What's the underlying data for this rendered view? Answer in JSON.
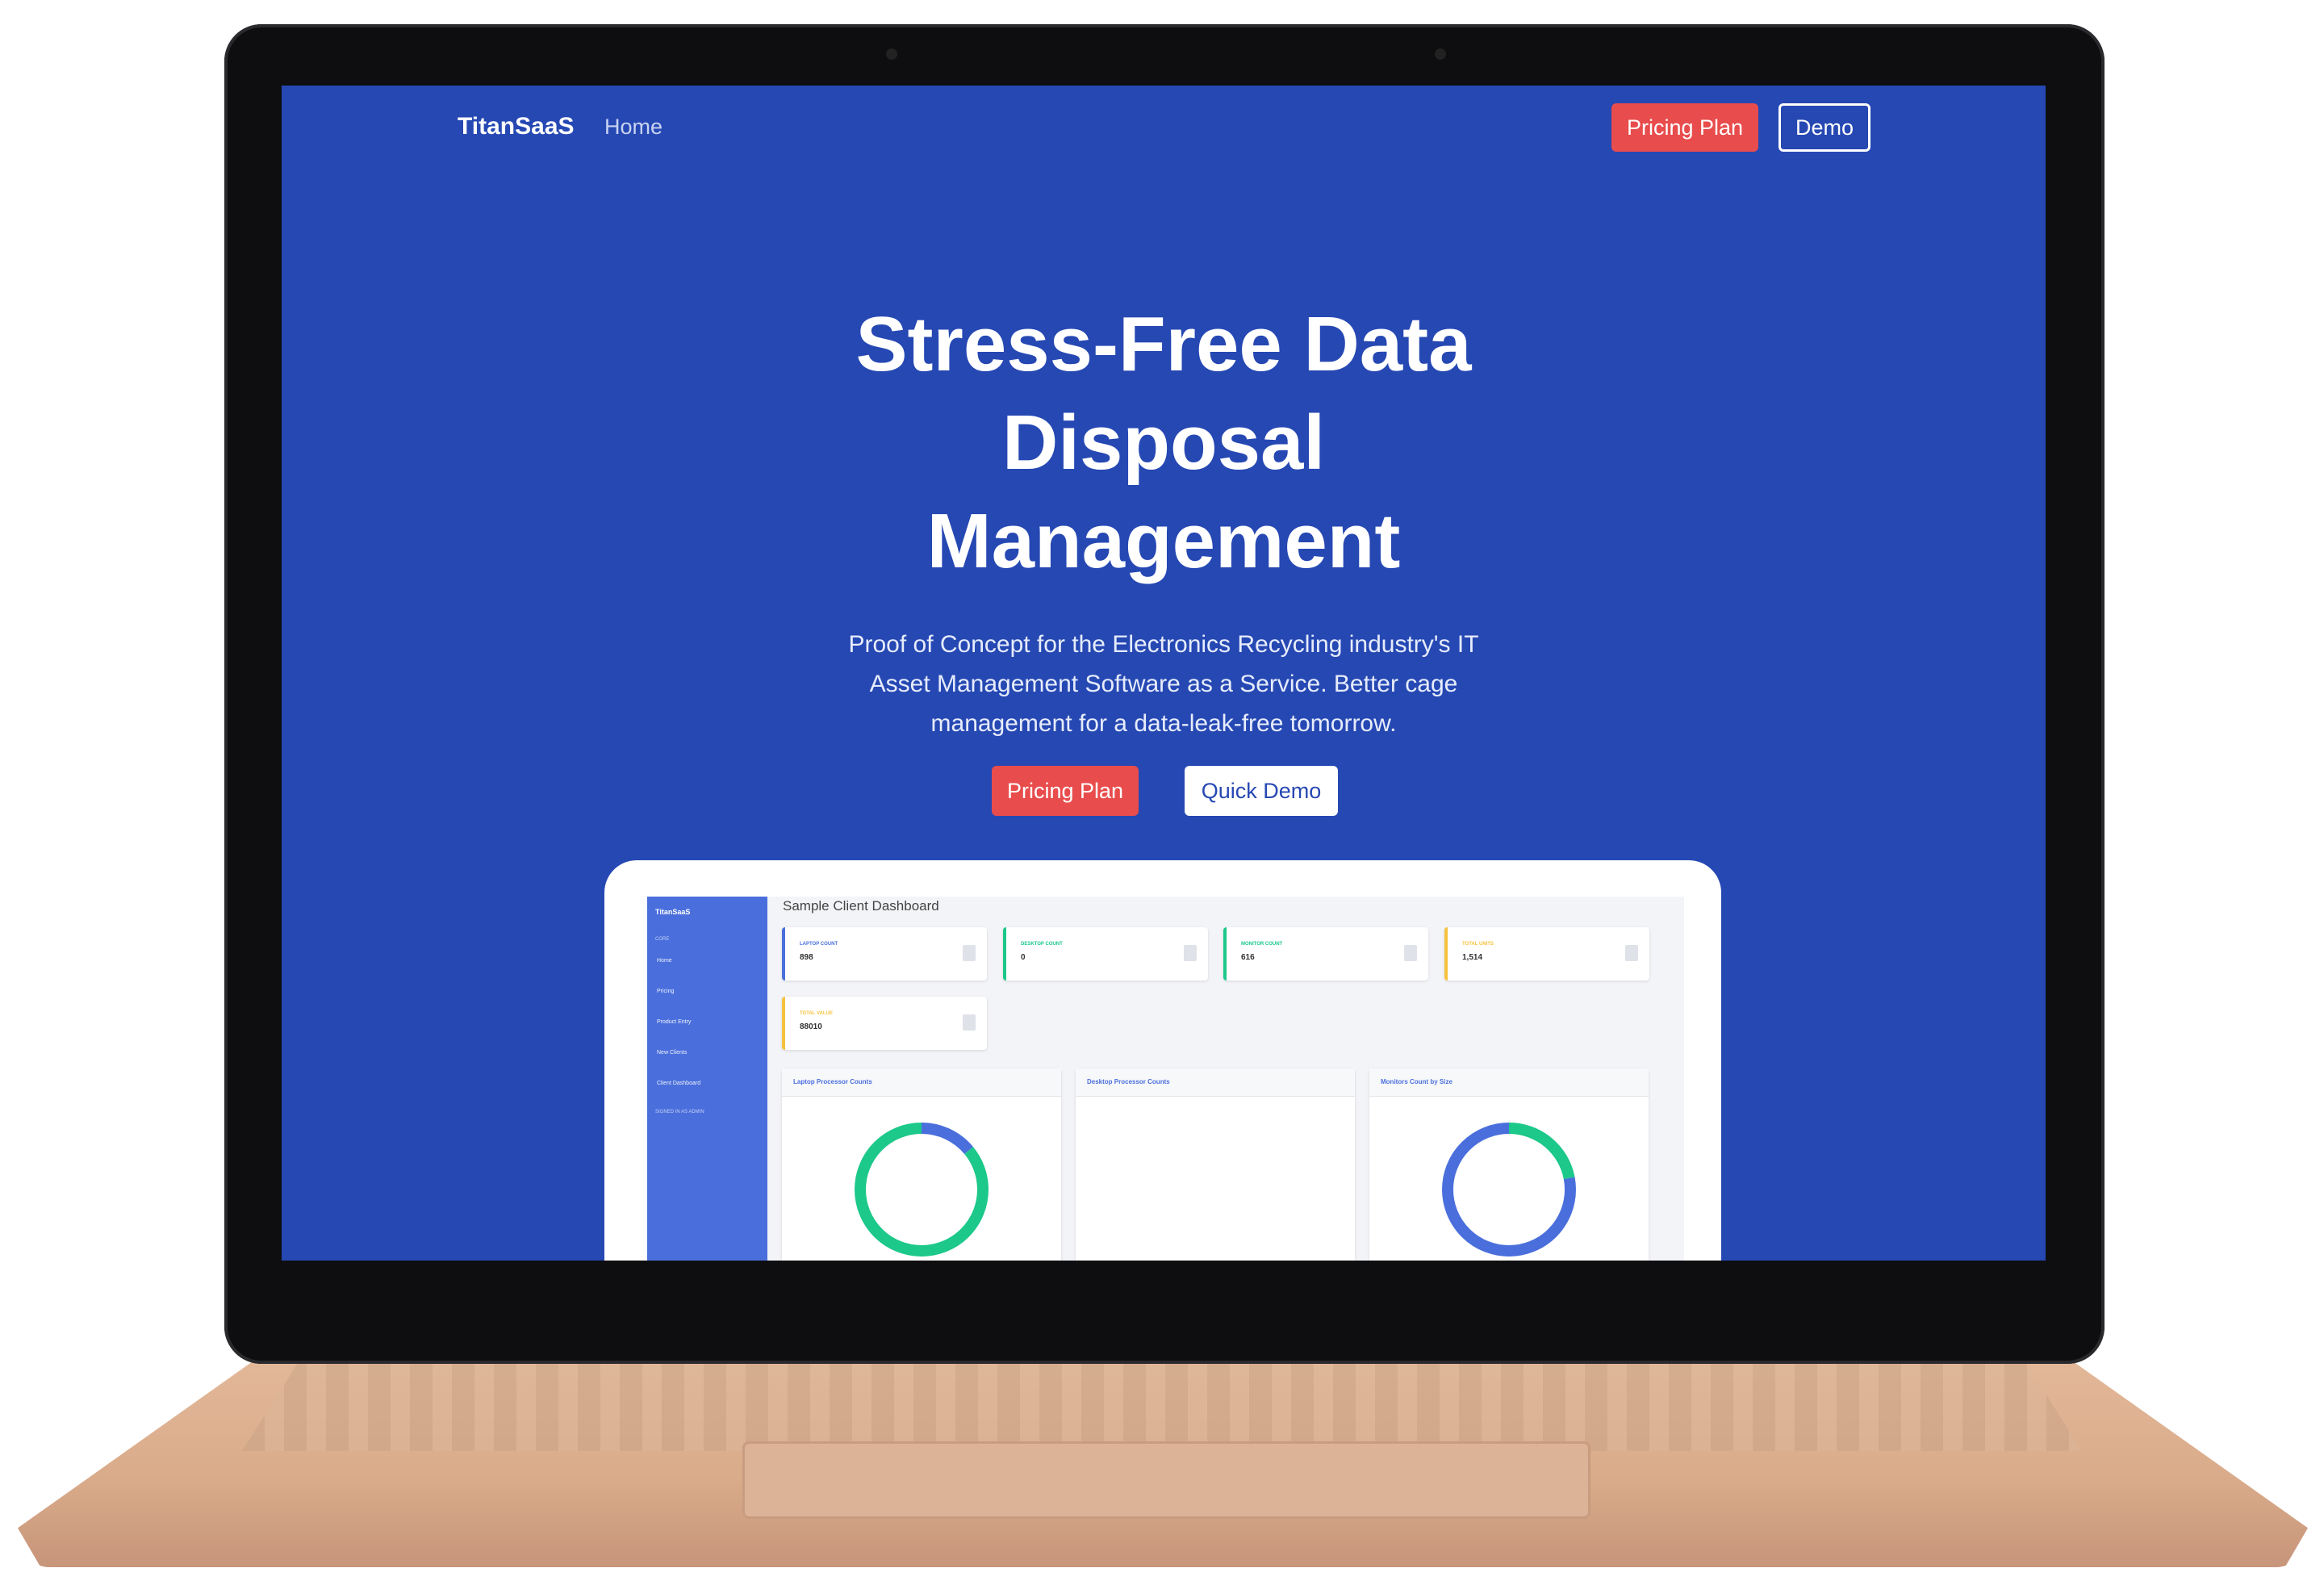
{
  "nav": {
    "brand": "TitanSaaS",
    "home": "Home",
    "pricing_button": "Pricing Plan",
    "demo_button": "Demo"
  },
  "hero": {
    "title_lines": [
      "Stress-Free Data",
      "Disposal",
      "Management"
    ],
    "subtitle_lines": [
      "Proof of Concept for the Electronics Recycling industry's IT",
      "Asset Management Software as a Service. Better cage",
      "management for a data-leak-free tomorrow."
    ],
    "cta_pricing": "Pricing Plan",
    "cta_demo": "Quick Demo"
  },
  "dashboard": {
    "title": "Sample Client Dashboard",
    "sidebar": {
      "brand": "TitanSaaS",
      "section": "CORE",
      "items": [
        "Home",
        "Pricing",
        "Product Entry",
        "New Clients",
        "Client Dashboard"
      ],
      "footer": "SIGNED IN AS ADMIN"
    },
    "stats": [
      {
        "label": "LAPTOP COUNT",
        "value": "898",
        "color": "#4a6fdc"
      },
      {
        "label": "DESKTOP COUNT",
        "value": "0",
        "color": "#1cc88a"
      },
      {
        "label": "MONITOR COUNT",
        "value": "616",
        "color": "#1cc88a"
      },
      {
        "label": "TOTAL UNITS",
        "value": "1,514",
        "color": "#f6c23e"
      },
      {
        "label": "TOTAL VALUE",
        "value": "88010",
        "color": "#f6c23e"
      }
    ],
    "panels": [
      {
        "title": "Laptop Processor Counts",
        "donut": [
          0.14,
          0.86
        ],
        "colors": [
          "#4a6fdc",
          "#1cc88a"
        ]
      },
      {
        "title": "Desktop Processor Counts"
      },
      {
        "title": "Monitors Count by Size",
        "donut": [
          0.22,
          0.78
        ],
        "colors": [
          "#1cc88a",
          "#4a6fdc"
        ]
      }
    ]
  },
  "colors": {
    "hero_bg": "#2648b3",
    "accent_red": "#e84c4c",
    "laptop_gold": "#dcb194"
  }
}
